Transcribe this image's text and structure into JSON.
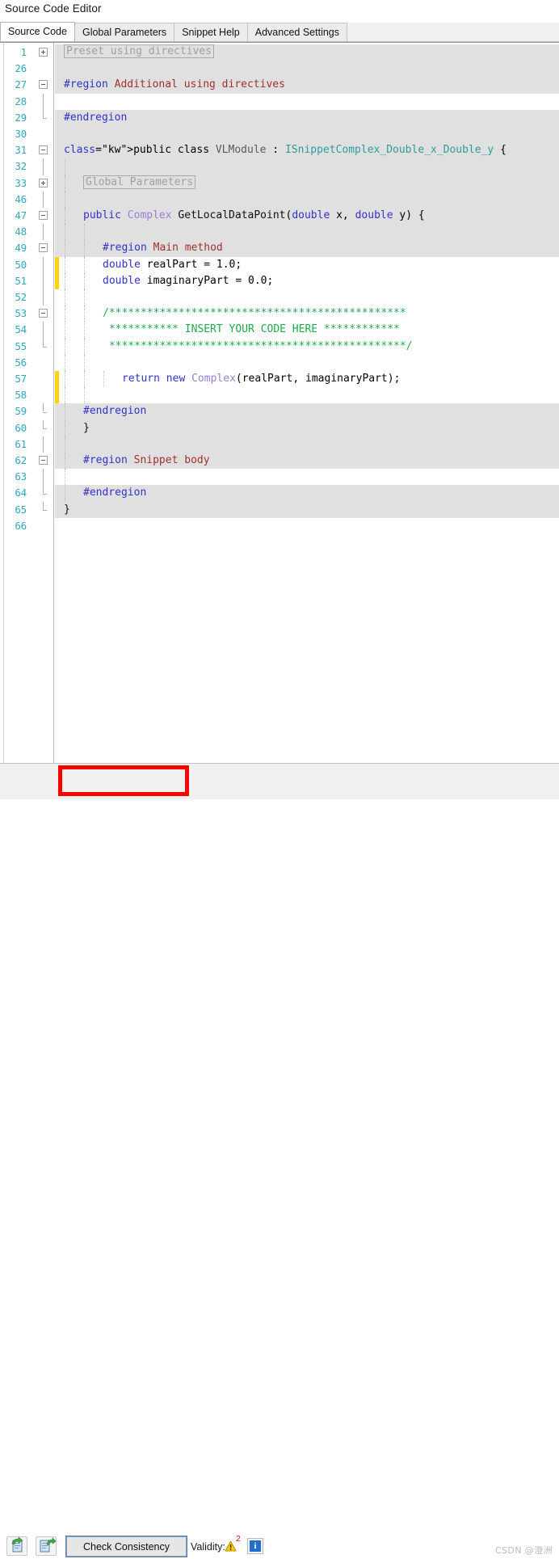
{
  "window": {
    "title": "Source Code Editor"
  },
  "tabs": [
    {
      "label": "Source Code",
      "active": true
    },
    {
      "label": "Global Parameters",
      "active": false
    },
    {
      "label": "Snippet Help",
      "active": false
    },
    {
      "label": "Advanced Settings",
      "active": false
    }
  ],
  "editor": {
    "line_number_color": "#2fa8bd",
    "readonly_bg": "#e0e0e0",
    "editable_bg": "#ffffff",
    "changebar_color": "#ffd400",
    "lines": [
      {
        "num": "1",
        "kind": "ro",
        "fold": "plus",
        "content": "pill:Preset using directives",
        "indent": 0
      },
      {
        "num": "26",
        "kind": "ro",
        "fold": "",
        "content": "",
        "indent": 0
      },
      {
        "num": "27",
        "kind": "ro",
        "fold": "minus",
        "content": "#region Additional using directives",
        "indent": 0
      },
      {
        "num": "28",
        "kind": "rw",
        "fold": "line",
        "content": "",
        "indent": 0
      },
      {
        "num": "29",
        "kind": "ro",
        "fold": "end",
        "content": "#endregion",
        "indent": 0
      },
      {
        "num": "30",
        "kind": "ro",
        "fold": "",
        "content": "",
        "indent": 0
      },
      {
        "num": "31",
        "kind": "ro",
        "fold": "minus",
        "content": "public class VLModule : ISnippetComplex_Double_x_Double_y {",
        "indent": 0
      },
      {
        "num": "32",
        "kind": "ro",
        "fold": "line",
        "content": "",
        "indent": 1
      },
      {
        "num": "33",
        "kind": "ro",
        "fold": "plus",
        "content": "pill:Global Parameters",
        "indent": 1
      },
      {
        "num": "46",
        "kind": "ro",
        "fold": "line",
        "content": "",
        "indent": 1
      },
      {
        "num": "47",
        "kind": "ro",
        "fold": "minus",
        "content": "public Complex GetLocalDataPoint(double x, double y) {",
        "indent": 1
      },
      {
        "num": "48",
        "kind": "ro",
        "fold": "line",
        "content": "",
        "indent": 2
      },
      {
        "num": "49",
        "kind": "ro",
        "fold": "minus",
        "content": "#region Main method",
        "indent": 2
      },
      {
        "num": "50",
        "kind": "rw",
        "fold": "line",
        "content": "double realPart = 1.0;",
        "indent": 2,
        "changed": true
      },
      {
        "num": "51",
        "kind": "rw",
        "fold": "line",
        "content": "double imaginaryPart = 0.0;",
        "indent": 2,
        "changed": true
      },
      {
        "num": "52",
        "kind": "rw",
        "fold": "line",
        "content": "",
        "indent": 2
      },
      {
        "num": "53",
        "kind": "rw",
        "fold": "minus",
        "content": "/***********************************************",
        "indent": 2
      },
      {
        "num": "54",
        "kind": "rw",
        "fold": "line",
        "content": " *********** INSERT YOUR CODE HERE ************",
        "indent": 2
      },
      {
        "num": "55",
        "kind": "rw",
        "fold": "end",
        "content": " ***********************************************/",
        "indent": 2
      },
      {
        "num": "56",
        "kind": "rw",
        "fold": "",
        "content": "",
        "indent": 2
      },
      {
        "num": "57",
        "kind": "rw",
        "fold": "",
        "content": "return new Complex(realPart, imaginaryPart);",
        "indent": 3,
        "changed": true
      },
      {
        "num": "58",
        "kind": "rw",
        "fold": "",
        "content": "",
        "indent": 2,
        "changed": true
      },
      {
        "num": "59",
        "kind": "ro",
        "fold": "end",
        "content": "#endregion",
        "indent": 1
      },
      {
        "num": "60",
        "kind": "ro",
        "fold": "end",
        "content": "}",
        "indent": 1
      },
      {
        "num": "61",
        "kind": "ro",
        "fold": "line",
        "content": "",
        "indent": 1
      },
      {
        "num": "62",
        "kind": "ro",
        "fold": "minus",
        "content": "#region Snippet body",
        "indent": 1
      },
      {
        "num": "63",
        "kind": "rw",
        "fold": "line",
        "content": "",
        "indent": 1
      },
      {
        "num": "64",
        "kind": "ro",
        "fold": "end",
        "content": "#endregion",
        "indent": 1
      },
      {
        "num": "65",
        "kind": "ro",
        "fold": "end",
        "content": "}",
        "indent": 0
      },
      {
        "num": "66",
        "kind": "none",
        "fold": "",
        "content": "",
        "indent": 0
      }
    ]
  },
  "toolbar": {
    "import_icon": "import-document-icon",
    "export_icon": "export-document-icon",
    "check_consistency_label": "Check Consistency",
    "validity_label": "Validity:",
    "warning_icon": "warning-triangle-icon",
    "warning_count": "2",
    "info_icon": "info-icon",
    "accent_focus_color": "#3f87d4",
    "annotation_color": "#ff0000"
  },
  "watermark": {
    "text": "CSDN @澄洲"
  }
}
